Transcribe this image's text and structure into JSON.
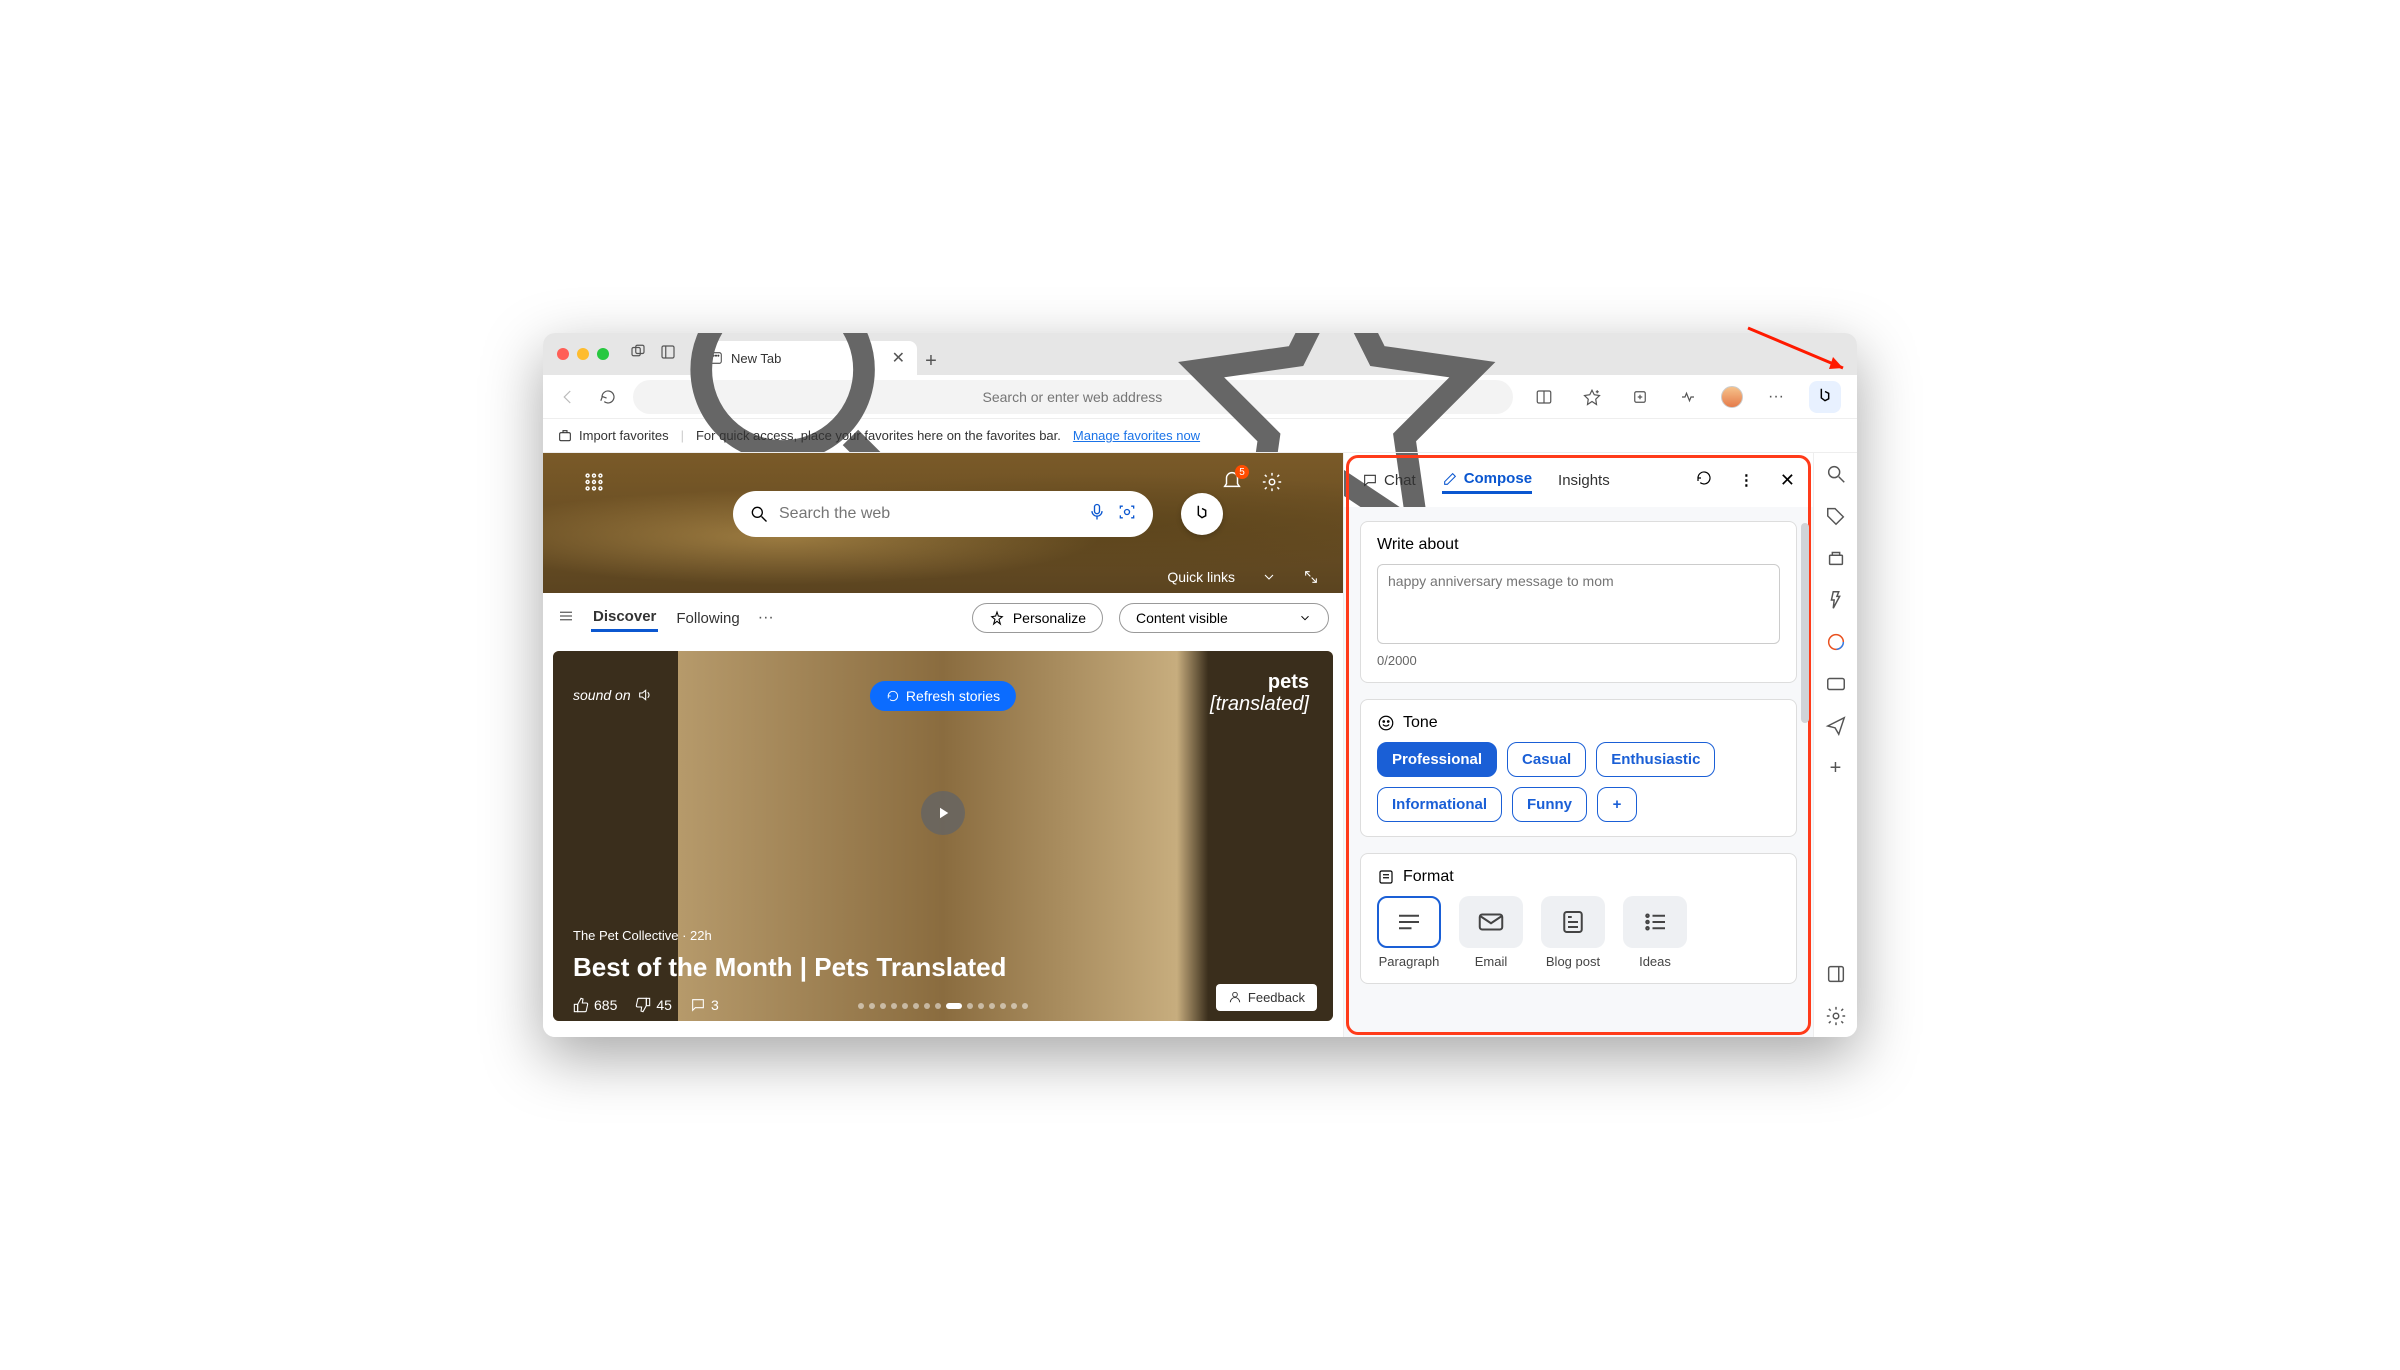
{
  "window": {
    "tab_title": "New Tab",
    "address_placeholder": "Search or enter web address",
    "address_value": ""
  },
  "favorites_bar": {
    "import": "Import favorites",
    "hint": "For quick access, place your favorites here on the favorites bar.",
    "manage_link": "Manage favorites now"
  },
  "ntp": {
    "search_placeholder": "Search the web",
    "quick_links_label": "Quick links",
    "notification_count": "5"
  },
  "feed": {
    "tabs": {
      "discover": "Discover",
      "following": "Following"
    },
    "personalize": "Personalize",
    "content_visible": "Content visible",
    "refresh": "Refresh stories",
    "sound_label": "sound on",
    "brand_top": "pets",
    "brand_bottom": "[translated]",
    "source": "The Pet Collective · 22h",
    "title": "Best of the Month | Pets Translated",
    "likes": "685",
    "dislikes": "45",
    "comments": "3",
    "feedback": "Feedback"
  },
  "panel": {
    "tabs": {
      "chat": "Chat",
      "compose": "Compose",
      "insights": "Insights"
    },
    "write_about": "Write about",
    "write_placeholder": "happy anniversary message to mom",
    "counter": "0/2000",
    "tone_label": "Tone",
    "tones": [
      "Professional",
      "Casual",
      "Enthusiastic",
      "Informational",
      "Funny"
    ],
    "tone_selected": "Professional",
    "format_label": "Format",
    "formats": [
      "Paragraph",
      "Email",
      "Blog post",
      "Ideas"
    ],
    "format_selected": "Paragraph"
  },
  "icons": {
    "back": "back-icon",
    "reload": "reload-icon",
    "search": "search-icon",
    "star": "star-icon",
    "split": "split-screen-icon",
    "favorites": "favorites-icon",
    "collections": "collections-icon",
    "health": "health-icon",
    "menu": "menu-icon",
    "bing": "bing-icon",
    "mic": "mic-icon",
    "lens": "lens-icon",
    "bell": "bell-icon",
    "gear": "gear-icon",
    "expand": "expand-icon",
    "like": "like-icon",
    "dislike": "dislike-icon",
    "comment": "comment-icon",
    "person": "person-icon"
  }
}
